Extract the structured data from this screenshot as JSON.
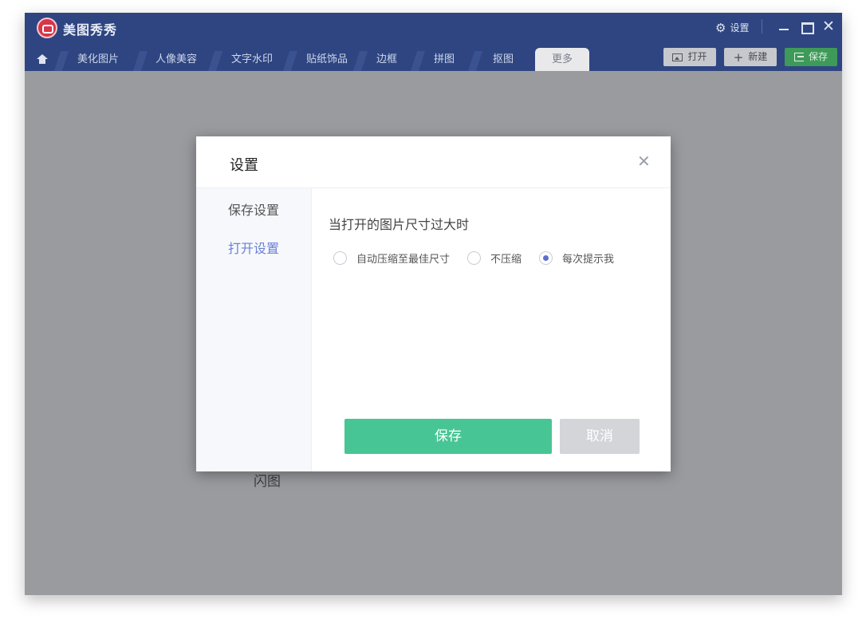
{
  "app": {
    "title": "美图秀秀",
    "settings_label": "设置"
  },
  "tabs": [
    {
      "label": "美化图片"
    },
    {
      "label": "人像美容"
    },
    {
      "label": "文字水印"
    },
    {
      "label": "贴纸饰品"
    },
    {
      "label": "边框"
    },
    {
      "label": "拼图"
    },
    {
      "label": "抠图"
    },
    {
      "label": "更多",
      "active": true
    }
  ],
  "toolbar": {
    "open_label": "打开",
    "new_label": "新建",
    "save_label": "保存"
  },
  "background": {
    "label": "闪图"
  },
  "dialog": {
    "title": "设置",
    "sidebar": [
      {
        "label": "保存设置"
      },
      {
        "label": "打开设置",
        "selected": true
      }
    ],
    "section_title": "当打开的图片尺寸过大时",
    "options": [
      {
        "label": "自动压缩至最佳尺寸",
        "checked": false
      },
      {
        "label": "不压缩",
        "checked": false
      },
      {
        "label": "每次提示我",
        "checked": true
      }
    ],
    "save_button": "保存",
    "cancel_button": "取消"
  },
  "colors": {
    "titlebar": "#2e4582",
    "accent": "#6a80d6",
    "save_green": "#48c594"
  }
}
